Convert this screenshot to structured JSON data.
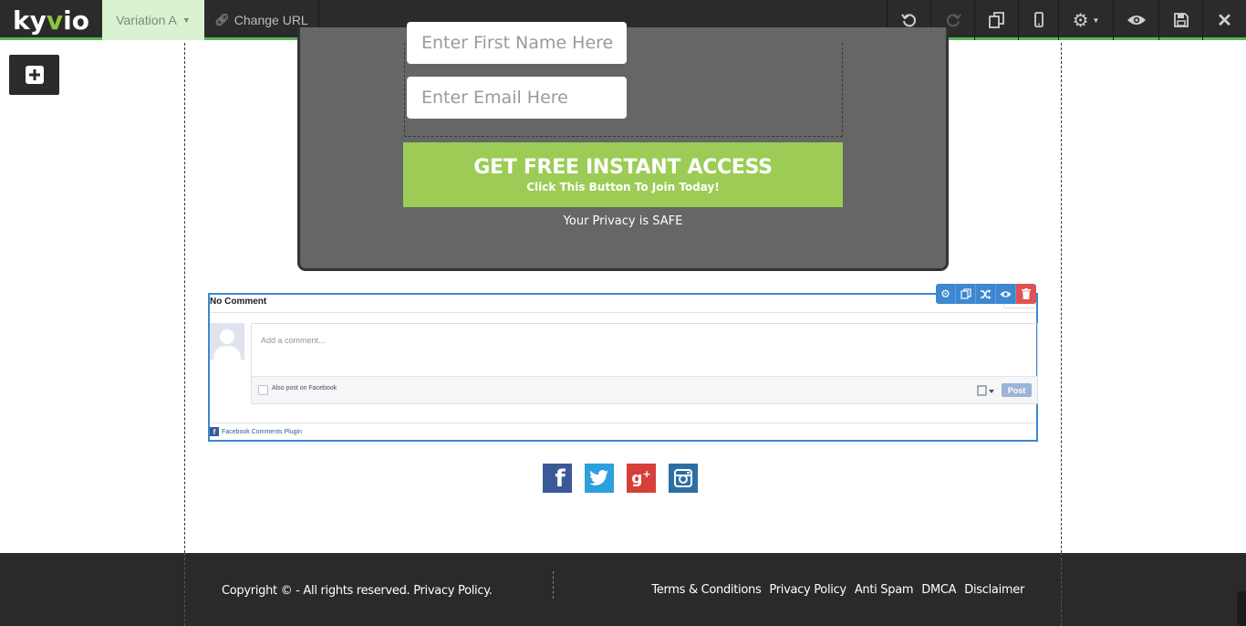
{
  "app": {
    "logo_text_a": "ky",
    "logo_text_b": "v",
    "logo_text_c": "io"
  },
  "toolbar": {
    "variation_label": "Variation A",
    "change_url_label": "Change URL",
    "tools": [
      "undo-icon",
      "redo-icon",
      "copy-icon",
      "mobile-icon",
      "gear-icon",
      "eye-icon",
      "save-icon",
      "close-icon"
    ]
  },
  "optin": {
    "first_name_placeholder": "Enter First Name Here",
    "email_placeholder": "Enter Email Here",
    "cta_main": "GET FREE INSTANT ACCESS",
    "cta_sub": "Click This Button To Join Today!",
    "privacy_text": "Your Privacy is SAFE"
  },
  "comments": {
    "title": "No Comment",
    "placeholder": "Add a comment...",
    "also_post_label": "Also post on Facebook",
    "post_label": "Post",
    "plugin_label": "Facebook Comments Plugin"
  },
  "social": [
    "facebook-icon",
    "twitter-icon",
    "google-plus-icon",
    "instagram-icon"
  ],
  "footer": {
    "copyright": "Copyright © - All rights reserved. Privacy Policy.",
    "links": [
      "Terms & Conditions",
      "Privacy Policy",
      "Anti Spam",
      "DMCA",
      "Disclaimer"
    ]
  },
  "colors": {
    "accent": "#5cb85c",
    "cta": "#9ccc55",
    "selection": "#3d88d1",
    "delete": "#e05252"
  }
}
